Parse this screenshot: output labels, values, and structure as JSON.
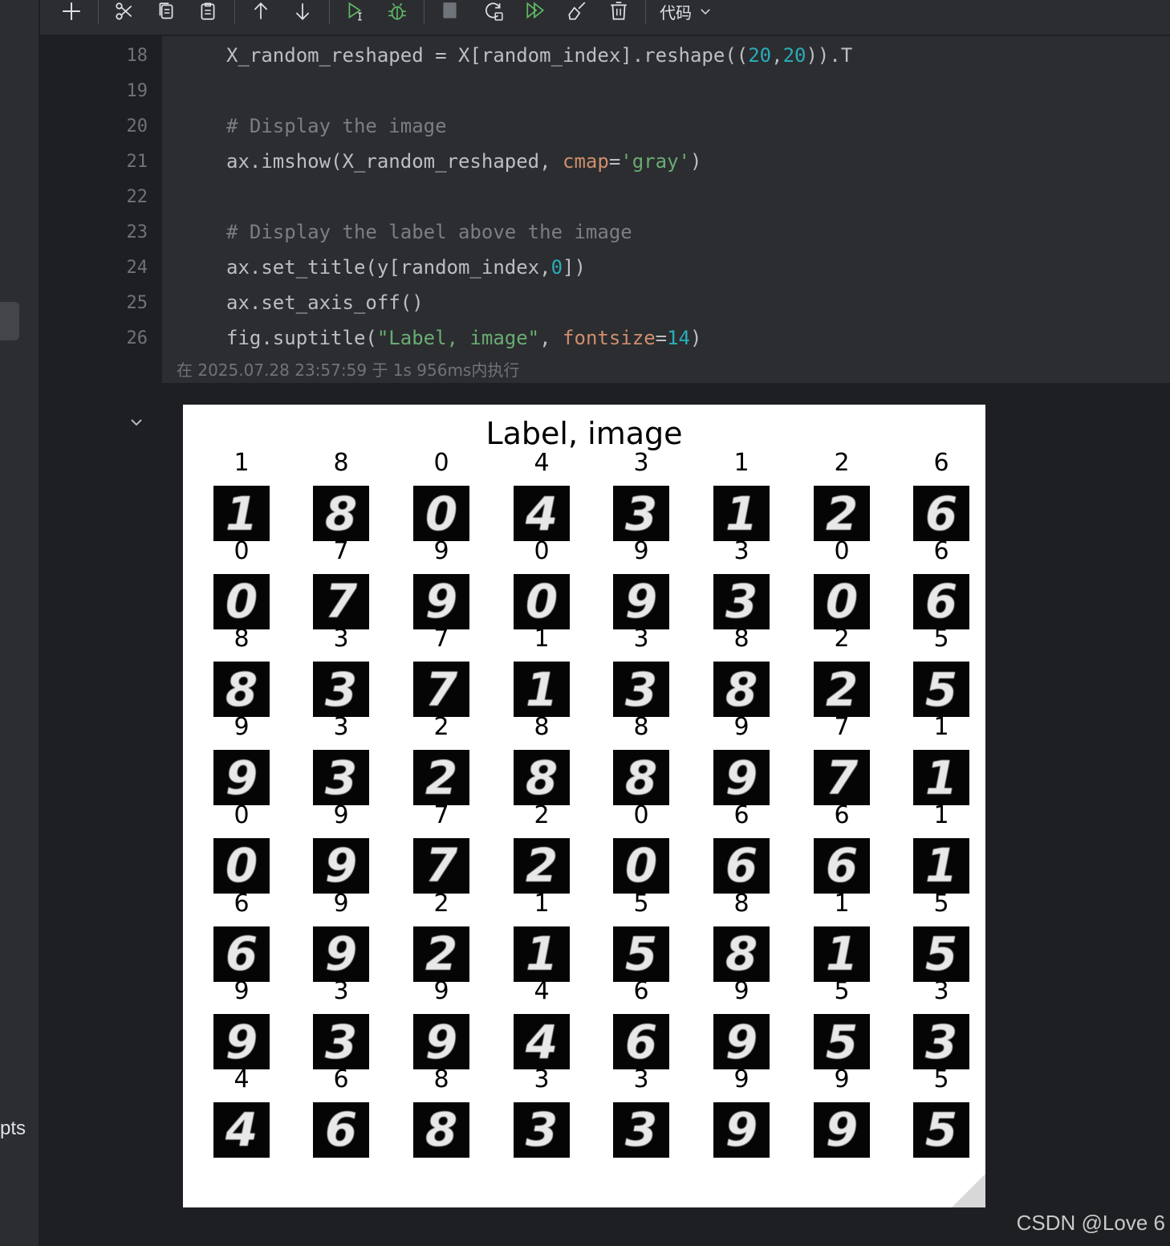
{
  "sidebar": {
    "partial_label": "pts"
  },
  "toolbar": {
    "cell_type": "代码",
    "icons": [
      "plus-icon",
      "cut-icon",
      "copy-icon",
      "paste-icon",
      "arrow-up-icon",
      "arrow-down-icon",
      "run-cursor-icon",
      "debug-icon",
      "stop-icon",
      "restart-run-icon",
      "run-all-icon",
      "clear-icon",
      "delete-icon",
      "chevron-down-icon"
    ]
  },
  "editor": {
    "lines": [
      {
        "n": "18",
        "parts": [
          [
            "plain",
            "X_random_reshaped = X[random_index].reshape(("
          ],
          [
            "num",
            "20"
          ],
          [
            "plain",
            ","
          ],
          [
            "num",
            "20"
          ],
          [
            "plain",
            "))."
          ],
          [
            "plain",
            "T"
          ]
        ]
      },
      {
        "n": "19",
        "parts": []
      },
      {
        "n": "20",
        "parts": [
          [
            "cmt",
            "# Display the image"
          ]
        ]
      },
      {
        "n": "21",
        "parts": [
          [
            "plain",
            "ax.imshow(X_random_reshaped, "
          ],
          [
            "kw",
            "cmap"
          ],
          [
            "plain",
            "="
          ],
          [
            "str",
            "'gray'"
          ],
          [
            "plain",
            ")"
          ]
        ]
      },
      {
        "n": "22",
        "parts": []
      },
      {
        "n": "23",
        "parts": [
          [
            "cmt",
            "# Display the label above the image"
          ]
        ]
      },
      {
        "n": "24",
        "parts": [
          [
            "plain",
            "ax.set_title(y[random_index,"
          ],
          [
            "num",
            "0"
          ],
          [
            "plain",
            "])"
          ]
        ]
      },
      {
        "n": "25",
        "parts": [
          [
            "plain",
            "ax.set_axis_off()"
          ]
        ]
      },
      {
        "n": "26",
        "parts": [
          [
            "plain",
            "fig.suptitle("
          ],
          [
            "str",
            "\"Label, image\""
          ],
          [
            "plain",
            ", "
          ],
          [
            "kw",
            "fontsize"
          ],
          [
            "plain",
            "="
          ],
          [
            "num",
            "14"
          ],
          [
            "plain",
            ")"
          ]
        ]
      }
    ],
    "exec_info": "在 2025.07.28 23:57:59 于 1s 956ms内执行"
  },
  "figure": {
    "suptitle": "Label, image",
    "labels": [
      [
        "1",
        "8",
        "0",
        "4",
        "3",
        "1",
        "2",
        "6"
      ],
      [
        "0",
        "7",
        "9",
        "0",
        "9",
        "3",
        "0",
        "6"
      ],
      [
        "8",
        "3",
        "7",
        "1",
        "3",
        "8",
        "2",
        "5"
      ],
      [
        "9",
        "3",
        "2",
        "8",
        "8",
        "9",
        "7",
        "1"
      ],
      [
        "0",
        "9",
        "7",
        "2",
        "0",
        "6",
        "6",
        "1"
      ],
      [
        "6",
        "9",
        "2",
        "1",
        "5",
        "8",
        "1",
        "5"
      ],
      [
        "9",
        "3",
        "9",
        "4",
        "6",
        "9",
        "5",
        "3"
      ],
      [
        "4",
        "6",
        "8",
        "3",
        "3",
        "9",
        "9",
        "5"
      ]
    ]
  },
  "watermark": "CSDN @Love 6"
}
